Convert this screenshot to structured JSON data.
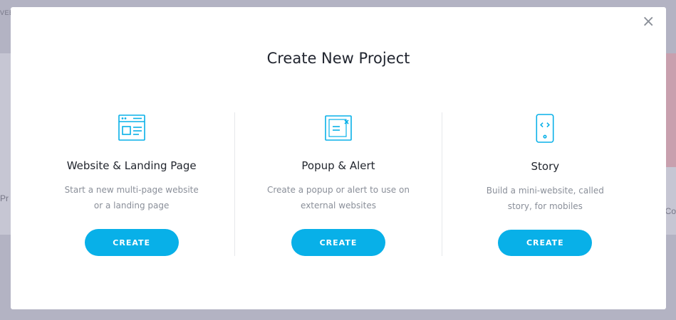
{
  "background": {
    "top_left_text": "VEE",
    "mid_left_text": "Pr",
    "mid_right_text": "Co"
  },
  "modal": {
    "title": "Create New Project",
    "close_label": "×",
    "options": [
      {
        "icon": "webpage-layout-icon",
        "title": "Website & Landing Page",
        "description": "Start a new multi-page website or a landing page",
        "button": "CREATE"
      },
      {
        "icon": "popup-window-icon",
        "title": "Popup & Alert",
        "description": "Create a popup or alert to use on external websites",
        "button": "CREATE"
      },
      {
        "icon": "mobile-code-icon",
        "title": "Story",
        "description": "Build a mini-website, called story, for mobiles",
        "button": "CREATE"
      }
    ]
  },
  "colors": {
    "accent": "#08b0e8",
    "overlay": "#b3b3c3",
    "title_text": "#222630",
    "desc_text": "#8a8f99"
  }
}
